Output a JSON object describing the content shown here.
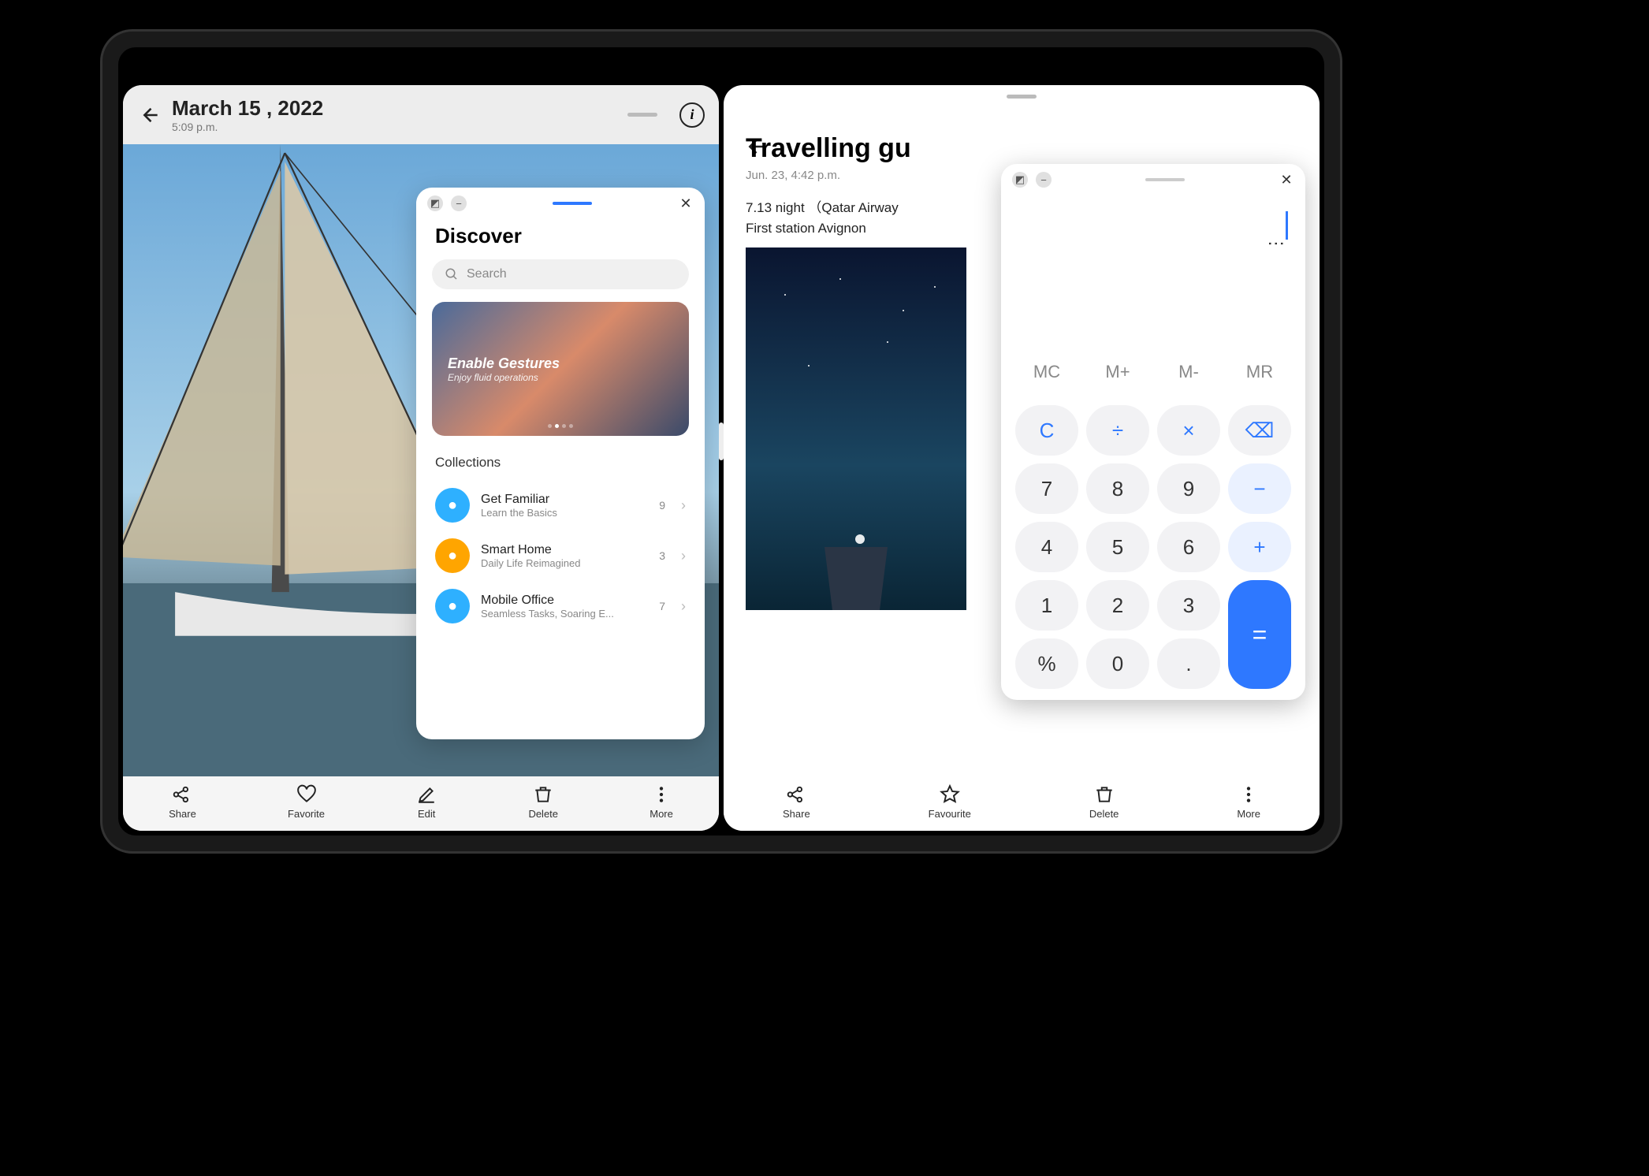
{
  "gallery": {
    "date": "March 15 , 2022",
    "time": "5:09 p.m.",
    "toolbar": [
      {
        "icon": "share",
        "label": "Share"
      },
      {
        "icon": "heart",
        "label": "Favorite"
      },
      {
        "icon": "edit",
        "label": "Edit"
      },
      {
        "icon": "trash",
        "label": "Delete"
      },
      {
        "icon": "more",
        "label": "More"
      }
    ]
  },
  "discover": {
    "title": "Discover",
    "search_placeholder": "Search",
    "banner": {
      "title": "Enable Gestures",
      "sub": "Enjoy fluid operations"
    },
    "collections_label": "Collections",
    "collections": [
      {
        "name": "Get Familiar",
        "sub": "Learn the Basics",
        "count": "9",
        "color": "#2eb0ff"
      },
      {
        "name": "Smart Home",
        "sub": "Daily Life Reimagined",
        "count": "3",
        "color": "#ffa500"
      },
      {
        "name": "Mobile Office",
        "sub": "Seamless Tasks, Soaring E...",
        "count": "7",
        "color": "#2eb0ff"
      }
    ]
  },
  "note": {
    "title": "Travelling gu",
    "date": "Jun. 23, 4:42 p.m.",
    "lines": [
      "7.13 night （Qatar Airway",
      "First station  Avignon"
    ],
    "toolbar": [
      {
        "icon": "share",
        "label": "Share"
      },
      {
        "icon": "star",
        "label": "Favourite"
      },
      {
        "icon": "trash",
        "label": "Delete"
      },
      {
        "icon": "more",
        "label": "More"
      }
    ]
  },
  "calculator": {
    "memory": [
      "MC",
      "M+",
      "M-",
      "MR"
    ],
    "rows": [
      [
        "C",
        "÷",
        "×",
        "⌫"
      ],
      [
        "7",
        "8",
        "9",
        "−"
      ],
      [
        "4",
        "5",
        "6",
        "+"
      ],
      [
        "1",
        "2",
        "3",
        "="
      ],
      [
        "%",
        "0",
        "."
      ]
    ]
  }
}
